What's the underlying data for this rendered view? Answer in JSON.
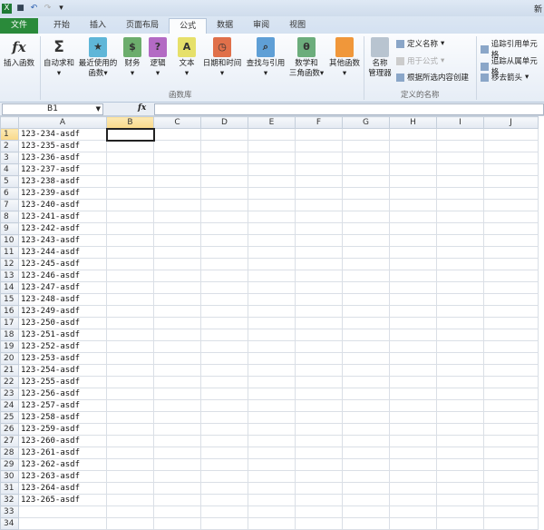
{
  "titlebar": {
    "title": "新",
    "qa": [
      "save-icon",
      "undo-icon",
      "redo-icon",
      "customize-icon"
    ]
  },
  "tabs": [
    "文件",
    "开始",
    "插入",
    "页面布局",
    "公式",
    "数据",
    "审阅",
    "视图"
  ],
  "active_tab": "公式",
  "ribbon": {
    "insert_function": "插入函数",
    "autosum": "自动求和",
    "recent": [
      "最近使用的",
      "函数"
    ],
    "financial": "财务",
    "logical": "逻辑",
    "text": "文本",
    "datetime": "日期和时间",
    "lookup": "查找与引用",
    "math": [
      "数学和",
      "三角函数"
    ],
    "more": "其他函数",
    "group_library": "函数库",
    "name_manager": [
      "名称",
      "管理器"
    ],
    "define_name": "定义名称",
    "use_in_formula": "用于公式",
    "create_from_selection": "根据所选内容创建",
    "group_names": "定义的名称",
    "trace_precedents": "追踪引用单元格",
    "trace_dependents": "追踪从属单元格",
    "remove_arrows": "移去箭头"
  },
  "formula_bar": {
    "name_box": "B1",
    "fx": "fx",
    "formula": ""
  },
  "columns": [
    "A",
    "B",
    "C",
    "D",
    "E",
    "F",
    "G",
    "H",
    "I",
    "J"
  ],
  "selected_cell": "B1",
  "rows": [
    "123-234-asdf",
    "123-235-asdf",
    "123-236-asdf",
    "123-237-asdf",
    "123-238-asdf",
    "123-239-asdf",
    "123-240-asdf",
    "123-241-asdf",
    "123-242-asdf",
    "123-243-asdf",
    "123-244-asdf",
    "123-245-asdf",
    "123-246-asdf",
    "123-247-asdf",
    "123-248-asdf",
    "123-249-asdf",
    "123-250-asdf",
    "123-251-asdf",
    "123-252-asdf",
    "123-253-asdf",
    "123-254-asdf",
    "123-255-asdf",
    "123-256-asdf",
    "123-257-asdf",
    "123-258-asdf",
    "123-259-asdf",
    "123-260-asdf",
    "123-261-asdf",
    "123-262-asdf",
    "123-263-asdf",
    "123-264-asdf",
    "123-265-asdf",
    "",
    ""
  ]
}
